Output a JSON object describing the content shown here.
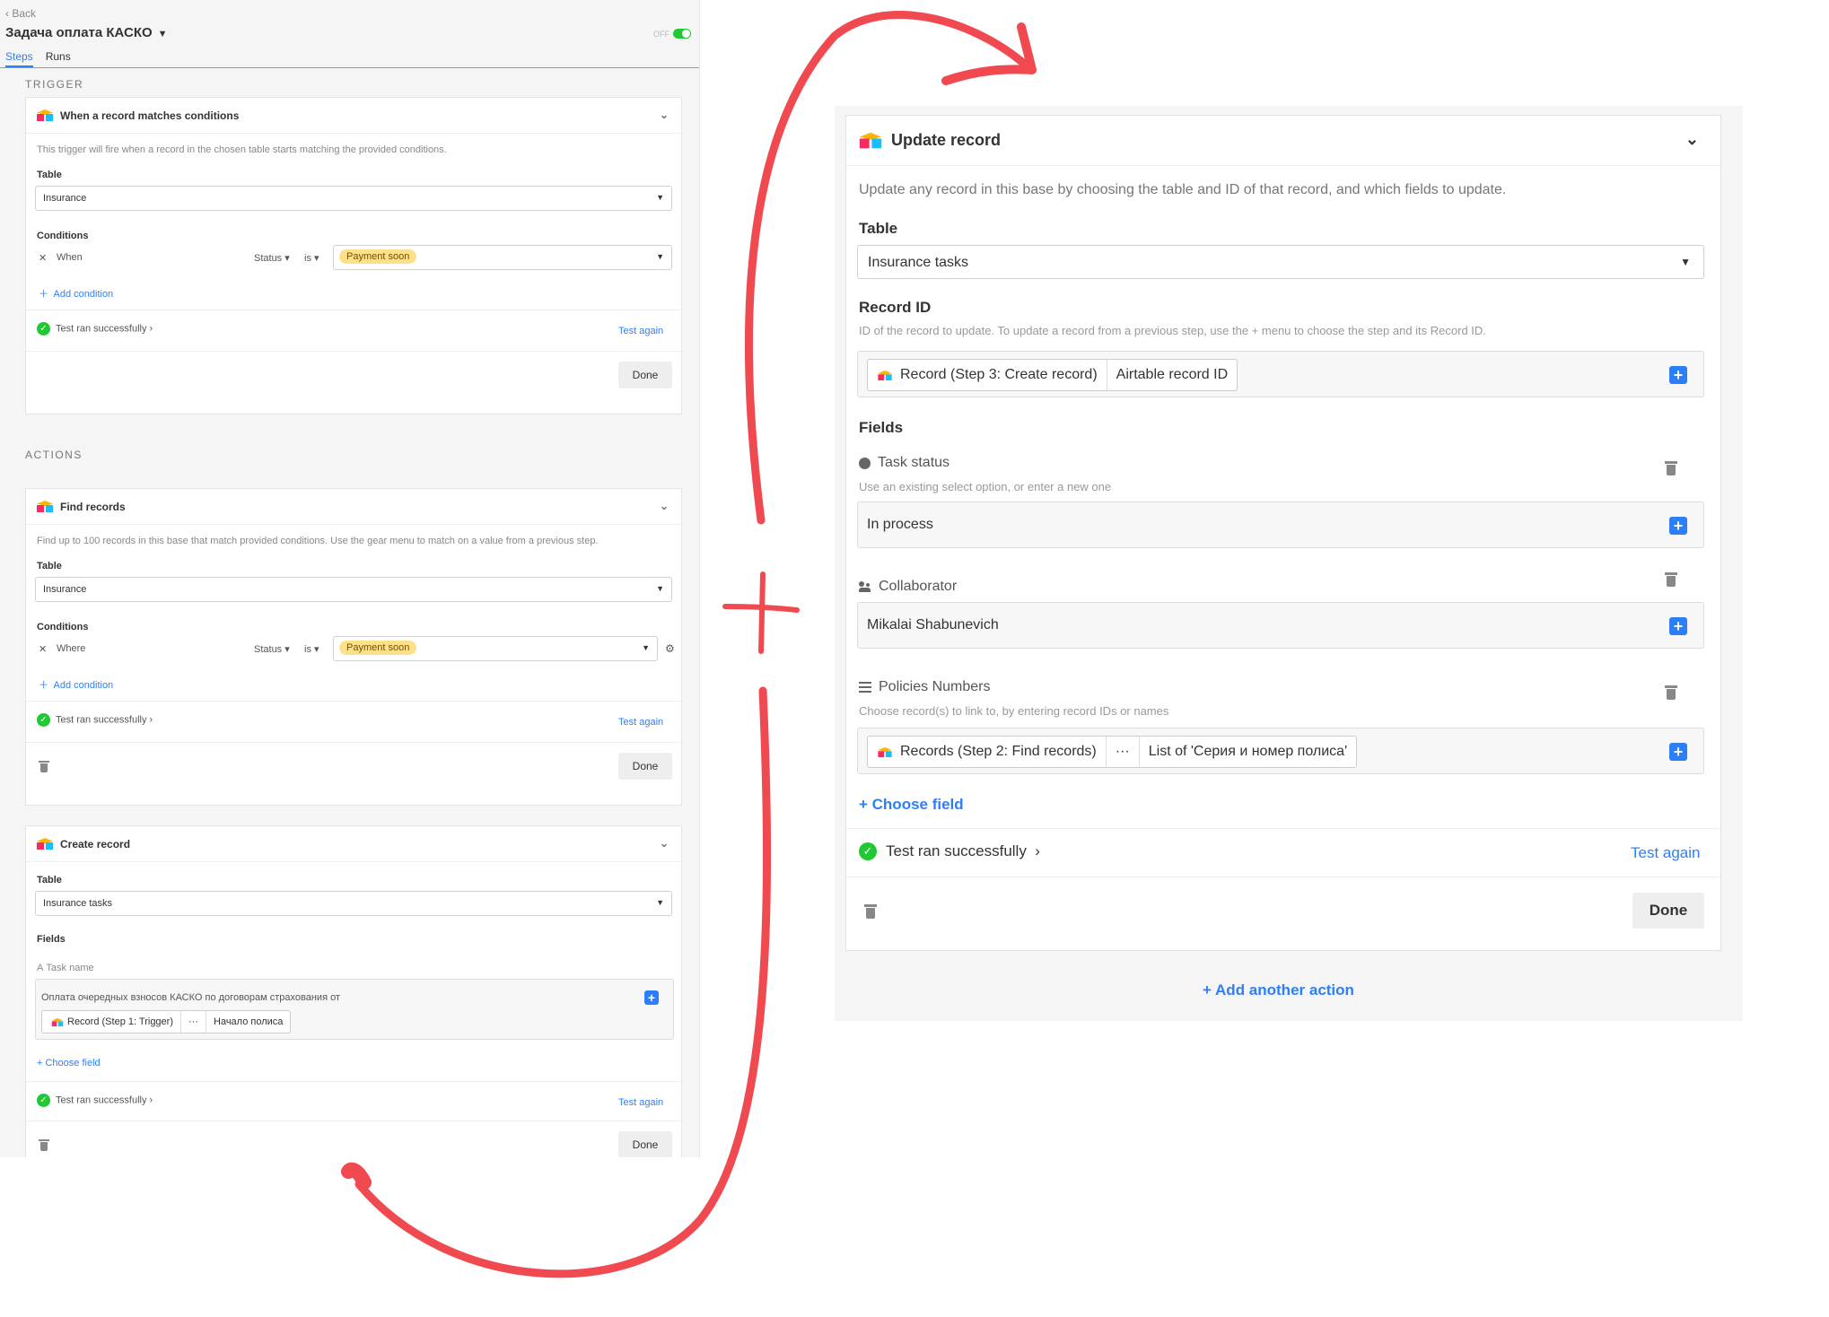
{
  "left": {
    "back_label": "Back",
    "title": "Задача оплата КАСКО",
    "toggle_off": "OFF",
    "tabs": [
      "Steps",
      "Runs"
    ],
    "trigger_label": "TRIGGER",
    "actions_label": "ACTIONS",
    "trigger": {
      "title": "When a record matches conditions",
      "description": "This trigger will fire when a record in the chosen table starts matching the provided conditions.",
      "table_label": "Table",
      "table_value": "Insurance",
      "conditions_label": "Conditions",
      "cond_prefix": "When",
      "cond_field": "Status",
      "cond_op": "is",
      "cond_value": "Payment soon",
      "add_condition": "Add condition",
      "test_status": "Test ran successfully",
      "test_again": "Test again",
      "done": "Done"
    },
    "find": {
      "title": "Find records",
      "description": "Find up to 100 records in this base that match provided conditions. Use the gear menu to match on a value from a previous step.",
      "table_label": "Table",
      "table_value": "Insurance",
      "conditions_label": "Conditions",
      "cond_prefix": "Where",
      "cond_field": "Status",
      "cond_op": "is",
      "cond_value": "Payment soon",
      "add_condition": "Add condition",
      "test_status": "Test ran successfully",
      "test_again": "Test again",
      "done": "Done"
    },
    "create": {
      "title": "Create record",
      "table_label": "Table",
      "table_value": "Insurance tasks",
      "fields_label": "Fields",
      "task_name_label": "Task name",
      "task_name_text": "Оплата очередных взносов КАСКО по договорам страхования от",
      "token_record": "Record (Step 1: Trigger)",
      "token_dots": "···",
      "token_field": "Начало полиса",
      "choose_field": "+ Choose field",
      "test_status": "Test ran successfully",
      "test_again": "Test again",
      "done": "Done"
    }
  },
  "right": {
    "title": "Update record",
    "description": "Update any record in this base by choosing the table and ID of that record, and which fields to update.",
    "table_label": "Table",
    "table_value": "Insurance tasks",
    "record_id_label": "Record ID",
    "record_id_help": "ID of the record to update. To update a record from a previous step, use the + menu to choose the step and its Record ID.",
    "record_token": "Record (Step 3: Create record)",
    "record_field": "Airtable record ID",
    "fields_label": "Fields",
    "task_status_label": "Task status",
    "task_status_help": "Use an existing select option, or enter a new one",
    "task_status_value": "In process",
    "collaborator_label": "Collaborator",
    "collaborator_value": "Mikalai Shabunevich",
    "policies_label": "Policies Numbers",
    "policies_help": "Choose record(s) to link to, by entering record IDs or names",
    "policies_token": "Records (Step 2: Find records)",
    "policies_dots": "···",
    "policies_field": "List of 'Серия и номер полиса'",
    "choose_field": "+ Choose field",
    "test_status": "Test ran successfully",
    "test_again": "Test again",
    "done": "Done",
    "add_action": "Add another action"
  },
  "colors": {
    "accent_blue": "#2d7ff9",
    "success_green": "#20c933",
    "pill_yellow": "#ffe08a",
    "annotation_red": "#f0494f"
  }
}
